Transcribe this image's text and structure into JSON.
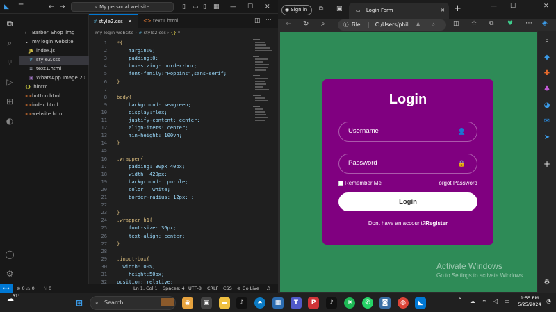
{
  "vscode": {
    "search_text": "My personal website",
    "explorer_items": [
      {
        "label": "Barber_Shop_img",
        "icon": "chevron-right-icon"
      },
      {
        "label": "my login website",
        "icon": "chevron-down-icon"
      },
      {
        "label": "index.js",
        "icon": "js-file-icon"
      },
      {
        "label": "style2.css",
        "icon": "css-file-icon"
      },
      {
        "label": "text1.html",
        "icon": "text-file-icon"
      },
      {
        "label": "WhatsApp Image 20...",
        "icon": "image-file-icon"
      },
      {
        "label": ".hintrc",
        "icon": "json-file-icon"
      },
      {
        "label": "botton.html",
        "icon": "html-file-icon"
      },
      {
        "label": "index.html",
        "icon": "html-file-icon"
      },
      {
        "label": "website.html",
        "icon": "html-file-icon"
      }
    ],
    "tabs": [
      {
        "label": "style2.css",
        "prefix": "#",
        "active": true
      },
      {
        "label": "text1.html",
        "prefix": "<>",
        "active": false
      }
    ],
    "breadcrumb": {
      "folder": "my login website",
      "file": "style2.css",
      "symbol": "*"
    },
    "code_lines": [
      {
        "n": "1",
        "t": "*{"
      },
      {
        "n": "2",
        "t": "    margin:0;"
      },
      {
        "n": "3",
        "t": "    padding:0;"
      },
      {
        "n": "4",
        "t": "    box-sizing: border-box;"
      },
      {
        "n": "5",
        "t": "    font-family:\"Poppins\",sans-serif;"
      },
      {
        "n": "6",
        "t": "}"
      },
      {
        "n": "7",
        "t": ""
      },
      {
        "n": "8",
        "t": "body{"
      },
      {
        "n": "9",
        "t": "    background: seagreen;"
      },
      {
        "n": "10",
        "t": "    display:flex;"
      },
      {
        "n": "11",
        "t": "    justify-content: center;"
      },
      {
        "n": "12",
        "t": "    align-items: center;"
      },
      {
        "n": "13",
        "t": "    min-height: 100vh;"
      },
      {
        "n": "14",
        "t": "}"
      },
      {
        "n": "15",
        "t": ""
      },
      {
        "n": "16",
        "t": ".wrapper{"
      },
      {
        "n": "17",
        "t": "    padding: 30px 40px;"
      },
      {
        "n": "18",
        "t": "    width: 420px;"
      },
      {
        "n": "19",
        "t": "    background:  purple;"
      },
      {
        "n": "20",
        "t": "    color:  white;"
      },
      {
        "n": "21",
        "t": "    border-radius: 12px; ;"
      },
      {
        "n": "22",
        "t": ""
      },
      {
        "n": "23",
        "t": "}"
      },
      {
        "n": "24",
        "t": ".wrapper h1{"
      },
      {
        "n": "25",
        "t": "    font-size: 36px;"
      },
      {
        "n": "26",
        "t": "    text-align: center;"
      },
      {
        "n": "27",
        "t": "}"
      },
      {
        "n": "28",
        "t": ""
      },
      {
        "n": "29",
        "t": ".input-box{"
      },
      {
        "n": "30",
        "t": "  width:100%;"
      },
      {
        "n": "31",
        "t": "    height:50px;"
      },
      {
        "n": "32",
        "t": "position: relative;"
      }
    ],
    "status": {
      "errors": "0",
      "warnings": "0",
      "ports": "0",
      "position": "Ln 1, Col 1",
      "spaces": "Spaces: 4",
      "encoding": "UTF-8",
      "eol": "CRLF",
      "language": "CSS",
      "golive": "Go Live"
    }
  },
  "browser": {
    "signin_label": "Sign in",
    "tab_title": "Login Form",
    "address_label": "File",
    "address": "C:/Users/phili...",
    "login": {
      "title": "Login",
      "username_placeholder": "Username",
      "password_placeholder": "Password",
      "remember": "Remember Me",
      "forgot": "Forgot Password",
      "button": "Login",
      "no_account": "Dont have an account?",
      "register": "Register"
    },
    "watermark_title": "Activate Windows",
    "watermark_sub": "Go to Settings to activate Windows."
  },
  "taskbar": {
    "weather": "31°",
    "search_label": "Search",
    "time": "1:55 PM",
    "date": "5/25/2024"
  },
  "colors": {
    "page_bg": "#2e8b57",
    "card_bg": "#800080",
    "vscode_accent": "#0078d4"
  }
}
